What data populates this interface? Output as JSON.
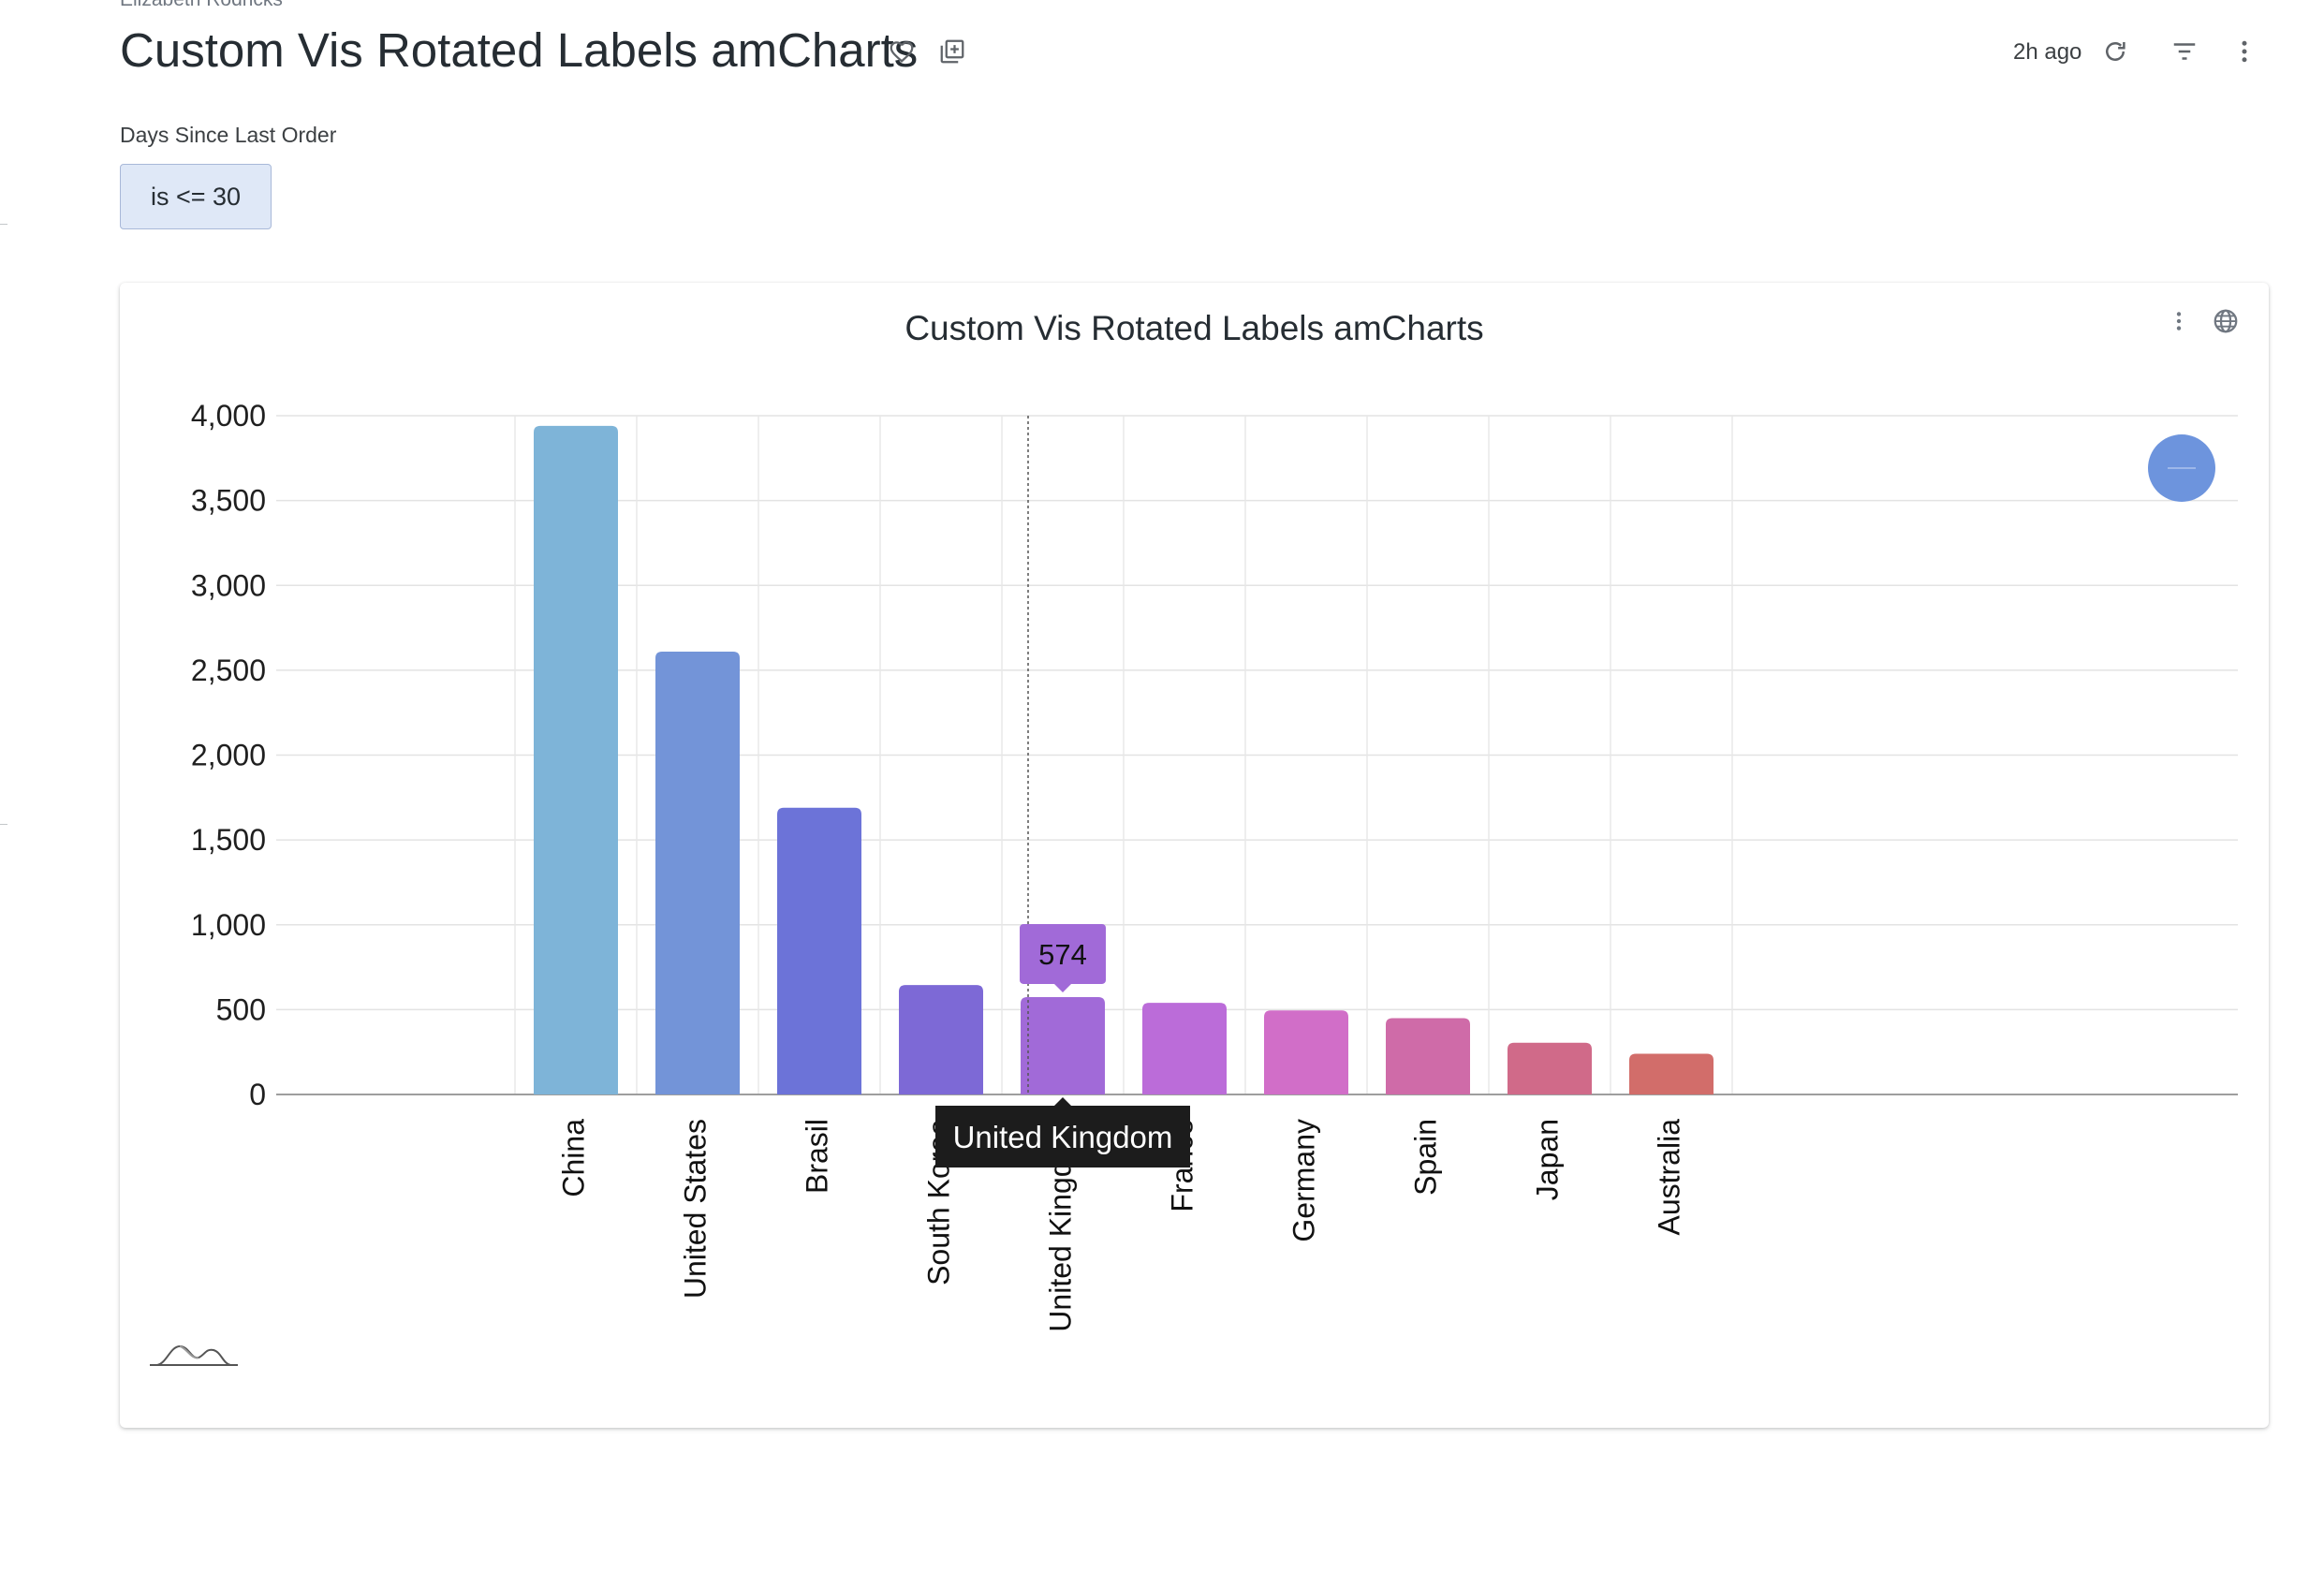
{
  "header": {
    "author": "Elizabeth Rodricks",
    "title": "Custom Vis Rotated Labels amCharts",
    "updated": "2h ago",
    "icons": [
      "heart-icon",
      "add-to-board-icon",
      "refresh-icon",
      "filter-icon",
      "more-vertical-icon"
    ]
  },
  "filter": {
    "label": "Days Since Last Order",
    "value": "is <= 30"
  },
  "tile": {
    "title": "Custom Vis Rotated Labels amCharts",
    "icons": [
      "more-vertical-icon",
      "globe-icon",
      "scrollbar-grip-icon",
      "zoom-out-icon"
    ]
  },
  "chart_data": {
    "type": "bar",
    "title": "Custom Vis Rotated Labels amCharts",
    "categories": [
      "China",
      "United States",
      "Brasil",
      "South Korea",
      "United Kingdom",
      "France",
      "Germany",
      "Spain",
      "Japan",
      "Australia"
    ],
    "values": [
      3940,
      2610,
      1690,
      645,
      574,
      540,
      495,
      450,
      305,
      240
    ],
    "colors": [
      "#7eb4d8",
      "#7394d8",
      "#6c73d8",
      "#7d69d6",
      "#a16ad8",
      "#bb6cd9",
      "#d16ec8",
      "#cf6ba8",
      "#d06a89",
      "#d26d6a"
    ],
    "ylim": [
      0,
      4000
    ],
    "yticks": [
      0,
      500,
      1000,
      1500,
      2000,
      2500,
      3000,
      3500,
      4000
    ],
    "ytick_labels": [
      "0",
      "500",
      "1,000",
      "1,500",
      "2,000",
      "2,500",
      "3,000",
      "3,500",
      "4,000"
    ],
    "xlabel_rotation": -90,
    "grid": true,
    "tooltip": {
      "category": "United Kingdom",
      "value": "574",
      "color": "#a16ad8"
    }
  }
}
